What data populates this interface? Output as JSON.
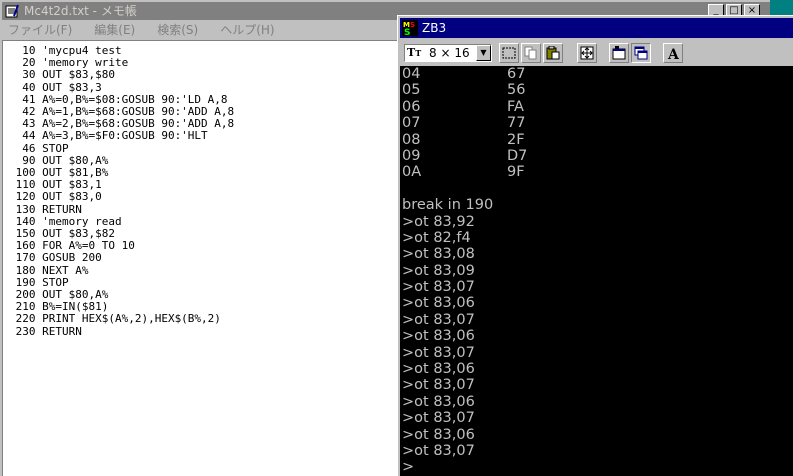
{
  "notepad": {
    "title": "Mc4t2d.txt - メモ帳",
    "menu": [
      "ファイル(F)",
      "編集(E)",
      "検索(S)",
      "ヘルプ(H)"
    ],
    "lines": [
      "  10 'mycpu4 test",
      "  20 'memory write",
      "  30 OUT $83,$80",
      "  40 OUT $83,3",
      "  41 A%=0,B%=$08:GOSUB 90:'LD A,8",
      "  42 A%=1,B%=$68:GOSUB 90:'ADD A,8",
      "  43 A%=2,B%=$68:GOSUB 90:'ADD A,8",
      "  44 A%=3,B%=$F0:GOSUB 90:'HLT",
      "  46 STOP",
      "  90 OUT $80,A%",
      " 100 OUT $81,B%",
      " 110 OUT $83,1",
      " 120 OUT $83,0",
      " 130 RETURN",
      " 140 'memory read",
      " 150 OUT $83,$82",
      " 160 FOR A%=0 TO 10",
      " 170 GOSUB 200",
      " 180 NEXT A%",
      " 190 STOP",
      " 200 OUT $80,A%",
      " 210 B%=IN($81)",
      " 220 PRINT HEX$(A%,2),HEX$(B%,2)",
      " 230 RETURN"
    ]
  },
  "zb3": {
    "title": "ZB3",
    "font_label": "8 × 16",
    "font_icon": "truetype-icon",
    "tool_icons": [
      "mark-icon",
      "copy-icon",
      "paste-icon",
      "fullscreen-icon",
      "properties-icon",
      "background-icon",
      "font-icon"
    ],
    "dump_rows": [
      {
        "addr": "04",
        "val": "67"
      },
      {
        "addr": "05",
        "val": "56"
      },
      {
        "addr": "06",
        "val": "FA"
      },
      {
        "addr": "07",
        "val": "77"
      },
      {
        "addr": "08",
        "val": "2F"
      },
      {
        "addr": "09",
        "val": "D7"
      },
      {
        "addr": "0A",
        "val": "9F"
      }
    ],
    "console_lines": [
      "break in 190",
      ">ot 83,92",
      ">ot 82,f4",
      ">ot 83,08",
      ">ot 83,09",
      ">ot 83,07",
      ">ot 83,06",
      ">ot 83,07",
      ">ot 83,06",
      ">ot 83,07",
      ">ot 83,06",
      ">ot 83,07",
      ">ot 83,06",
      ">ot 83,07",
      ">ot 83,06",
      ">ot 83,07",
      ">"
    ]
  }
}
